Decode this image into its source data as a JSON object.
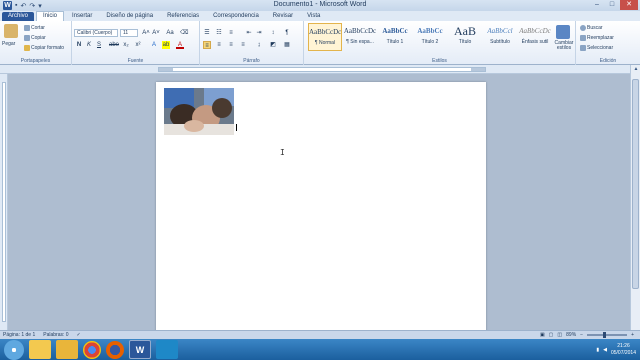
{
  "window": {
    "title": "Documento1 - Microsoft Word"
  },
  "qat": {
    "app_icon": "W"
  },
  "tabs": [
    {
      "label": "Archivo"
    },
    {
      "label": "Inicio"
    },
    {
      "label": "Insertar"
    },
    {
      "label": "Diseño de página"
    },
    {
      "label": "Referencias"
    },
    {
      "label": "Correspondencia"
    },
    {
      "label": "Revisar"
    },
    {
      "label": "Vista"
    }
  ],
  "clipboard": {
    "paste": "Pegar",
    "cut": "Cortar",
    "copy": "Copiar",
    "format_painter": "Copiar formato",
    "label": "Portapapeles"
  },
  "font": {
    "family": "Calibri (Cuerpo)",
    "size": "11",
    "label": "Fuente",
    "bold": "N",
    "italic": "K",
    "underline": "S",
    "strike": "abe",
    "sub": "x₂",
    "sup": "x²",
    "grow": "A˄",
    "shrink": "A˅",
    "aa": "Aa",
    "color_a": "A"
  },
  "paragraph": {
    "label": "Párrafo",
    "pilcrow": "¶"
  },
  "styles": {
    "label": "Estilos",
    "items": [
      {
        "sample": "AaBbCcDc",
        "name": "¶ Normal"
      },
      {
        "sample": "AaBbCcDc",
        "name": "¶ Sin espa..."
      },
      {
        "sample": "AaBbCc",
        "name": "Título 1"
      },
      {
        "sample": "AaBbCc",
        "name": "Título 2"
      },
      {
        "sample": "AaB",
        "name": "Título"
      },
      {
        "sample": "AaBbCcl",
        "name": "Subtítulo"
      },
      {
        "sample": "AaBbCcDc",
        "name": "Énfasis sutil"
      }
    ],
    "change_styles": "Cambiar estilos"
  },
  "editing": {
    "label": "Edición",
    "find": "Buscar",
    "replace": "Reemplazar",
    "select": "Seleccionar"
  },
  "statusbar": {
    "page": "Página: 1 de 1",
    "words": "Palabras: 0",
    "zoom": "89%"
  },
  "taskbar": {
    "time": "21:26",
    "date": "05/07/2014",
    "word_icon": "W"
  }
}
